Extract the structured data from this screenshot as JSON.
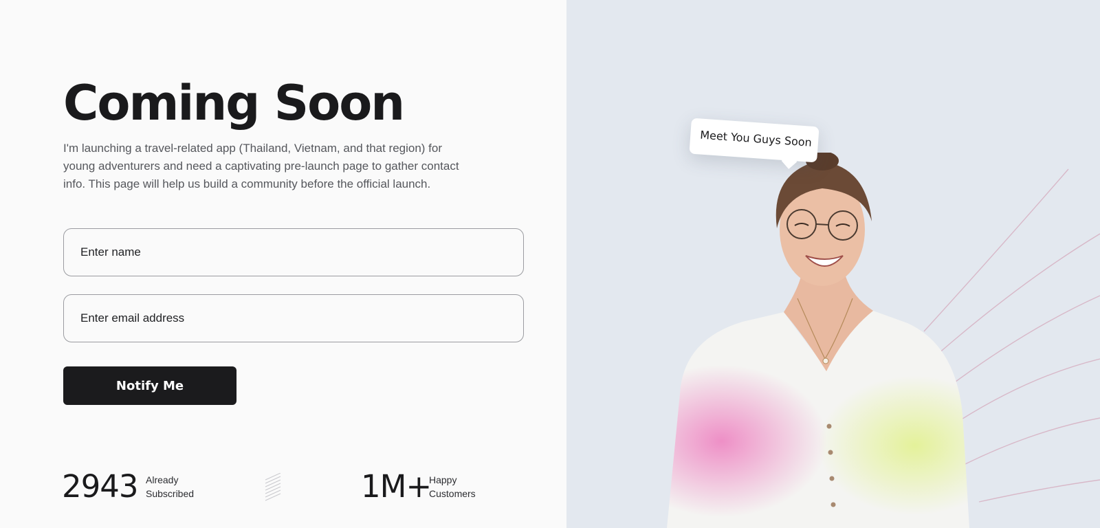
{
  "hero": {
    "title": "Coming Soon",
    "description": "I'm launching a travel-related app (Thailand, Vietnam, and that region) for young adventurers and need a captivating pre-launch page to gather contact info. This page will help us build a community before the official launch."
  },
  "form": {
    "name_placeholder": "Enter name",
    "email_placeholder": "Enter email address",
    "submit_label": "Notify Me"
  },
  "stats": {
    "subscribed": {
      "value": "2943",
      "label_line1": "Already",
      "label_line2": "Subscribed"
    },
    "customers": {
      "value": "1M+",
      "label_line1": "Happy",
      "label_line2": "Customers"
    }
  },
  "speech_bubble": {
    "text": "Meet You Guys Soon"
  },
  "colors": {
    "button_bg": "#1b1b1d",
    "panel_bg": "#e3e8ef",
    "page_bg": "#fafafa",
    "arc_line": "#d8b8c8"
  }
}
